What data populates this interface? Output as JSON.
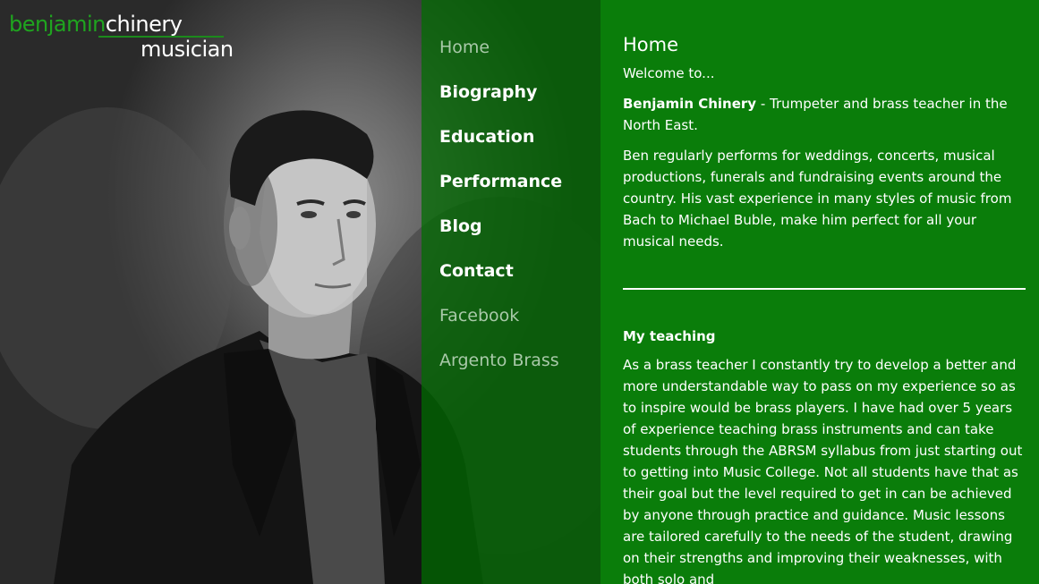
{
  "logo": {
    "first": "benjamin",
    "last": "chinery",
    "subtitle": "musician"
  },
  "nav": {
    "items": [
      {
        "label": "Home",
        "state": "active"
      },
      {
        "label": "Biography",
        "state": "item"
      },
      {
        "label": "Education",
        "state": "item"
      },
      {
        "label": "Performance",
        "state": "item"
      },
      {
        "label": "Blog",
        "state": "item"
      },
      {
        "label": "Contact",
        "state": "item"
      },
      {
        "label": "Facebook",
        "state": "ext"
      },
      {
        "label": "Argento Brass",
        "state": "ext"
      }
    ]
  },
  "content": {
    "title": "Home",
    "welcome": "Welcome to...",
    "intro_name": "Benjamin Chinery",
    "intro_rest": " - Trumpeter and brass teacher in the North East.",
    "paragraph1": "Ben regularly performs for weddings, concerts, musical productions, funerals and fundraising events around the country. His vast experience in many styles of music from Bach to Michael Buble, make him perfect for all your musical needs.",
    "teaching_heading": "My teaching",
    "teaching_text": "As a brass teacher I constantly try to develop a better and more understandable way to pass on my experience so as to inspire would be brass players. I have had over 5 years of experience teaching brass instruments and can take students through the ABRSM syllabus from just starting out to getting into Music College. Not all students have that as their goal but the level required to get in can be achieved by anyone through practice and guidance. Music lessons are tailored carefully to the needs of the student, drawing on their strengths and improving their weaknesses, with both solo and"
  },
  "colors": {
    "brand_green": "#0a7d0a",
    "logo_green": "#1fa51f",
    "nav_muted": "#a9c9a9"
  }
}
